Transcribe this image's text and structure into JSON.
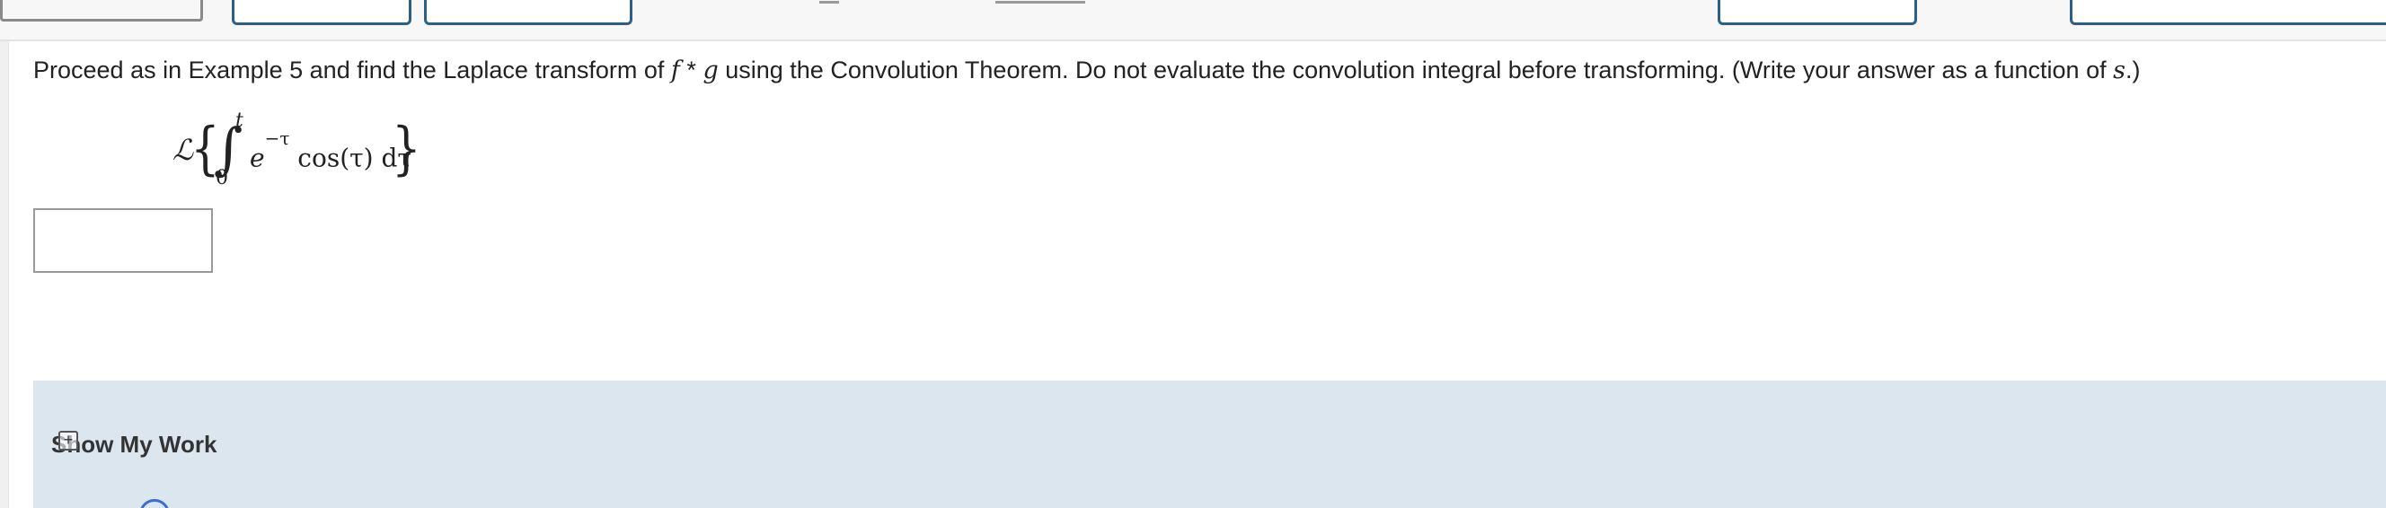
{
  "question": {
    "part1": "Proceed as in Example 5 and find the Laplace transform of ",
    "f": "f",
    "op": " * ",
    "g": "g",
    "part2": " using the Convolution Theorem. Do not evaluate the convolution integral before transforming. (Write your answer as a function of ",
    "s": "s",
    "part3": ".)"
  },
  "formula": {
    "laplace_symbol": "ℒ",
    "brace_open": "{",
    "integral": "∫",
    "upper_limit": "t",
    "lower_limit": "0",
    "base": "e",
    "exponent": "−τ",
    "rest": " cos(τ) dτ",
    "brace_close": "}"
  },
  "answer": {
    "value": ""
  },
  "show_work": {
    "label": "Show My Work",
    "icon": "plus-icon"
  }
}
